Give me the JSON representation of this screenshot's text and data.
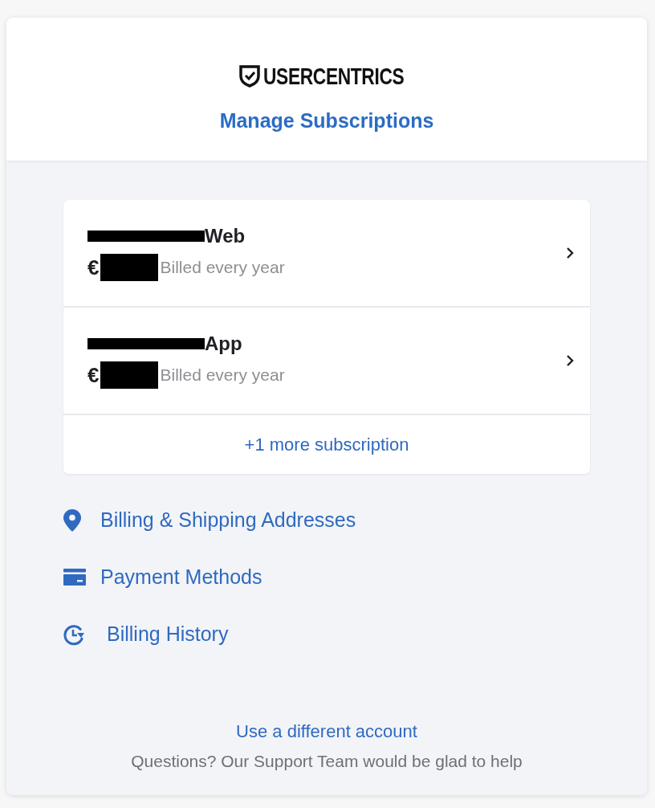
{
  "header": {
    "logo_text": "USERCENTRICS",
    "title": "Manage Subscriptions"
  },
  "subscriptions": [
    {
      "name": "Web",
      "currency": "€",
      "billing": "Billed every year",
      "redacted": true
    },
    {
      "name": "App",
      "currency": "€",
      "billing": "Billed every year",
      "redacted": true
    }
  ],
  "more_link": "+1 more subscription",
  "links": [
    {
      "kind": "pin",
      "label": "Billing & Shipping Addresses"
    },
    {
      "kind": "card",
      "label": "Payment Methods"
    },
    {
      "kind": "history",
      "label": "Billing History"
    }
  ],
  "footer": {
    "switch_account": "Use a different account",
    "support": "Questions? Our Support Team would be glad to help"
  }
}
